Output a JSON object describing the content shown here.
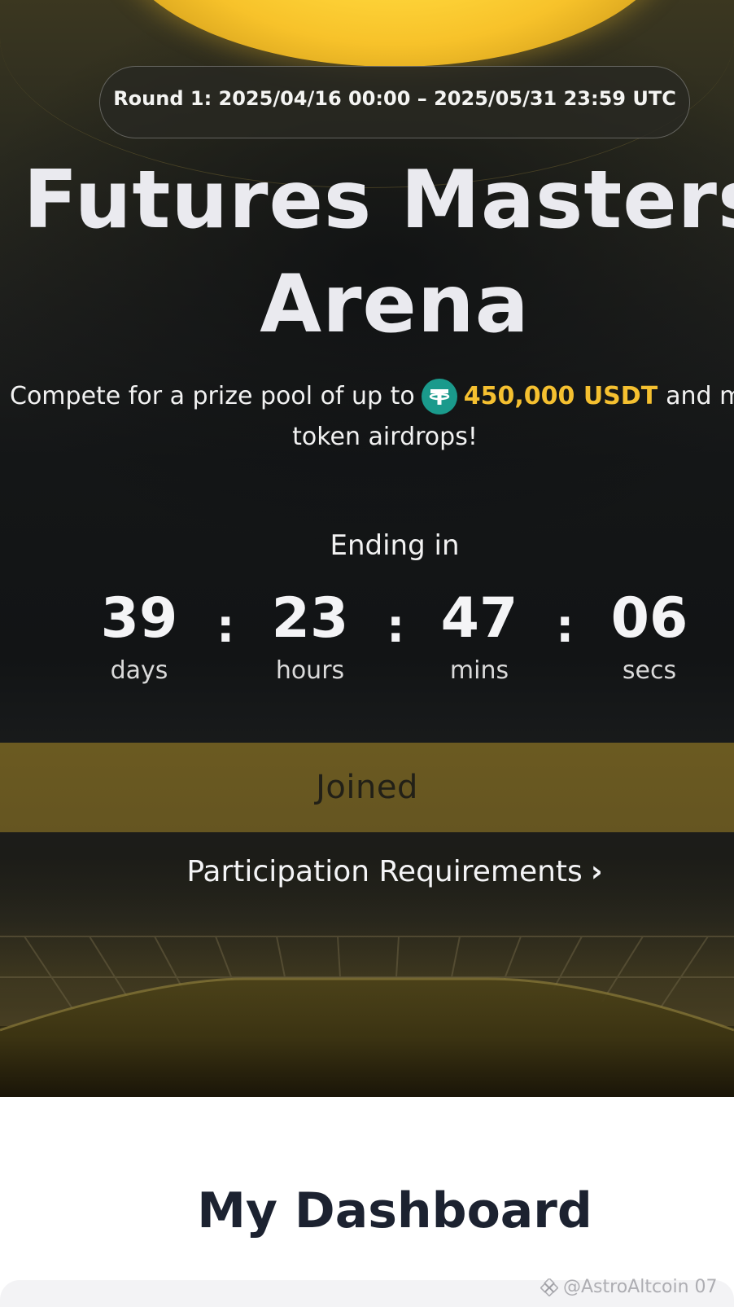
{
  "hero": {
    "round_text": "Round 1: 2025/04/16 00:00 – 2025/05/31 23:59 UTC",
    "title_line1": "Futures Masters",
    "title_line2": "Arena",
    "subtitle_prefix": "Compete for a prize pool of up to",
    "prize_amount": "450,000 USDT",
    "subtitle_suffix_line1": "and mult",
    "subtitle_line2": "token airdrops!",
    "ending_label": "Ending in",
    "countdown": [
      {
        "value": "39",
        "label": "days"
      },
      {
        "value": "23",
        "label": "hours"
      },
      {
        "value": "47",
        "label": "mins"
      },
      {
        "value": "06",
        "label": "secs"
      }
    ],
    "separator": ":",
    "joined_label": "Joined",
    "requirements_label": "Participation Requirements",
    "requirements_chevron": "›"
  },
  "dashboard": {
    "title": "My Dashboard"
  },
  "watermark": {
    "text": "@AstroAltcoin 07"
  },
  "colors": {
    "accent_gold": "#f5c030",
    "usdt_teal": "#1a9a8c",
    "joined_bg": "#6b5a21",
    "dashboard_title": "#1c2230"
  },
  "icons": {
    "prize_token": "usdt-tether-icon",
    "requirements_arrow": "chevron-right-icon",
    "watermark_logo": "binance-square-logo-icon"
  }
}
